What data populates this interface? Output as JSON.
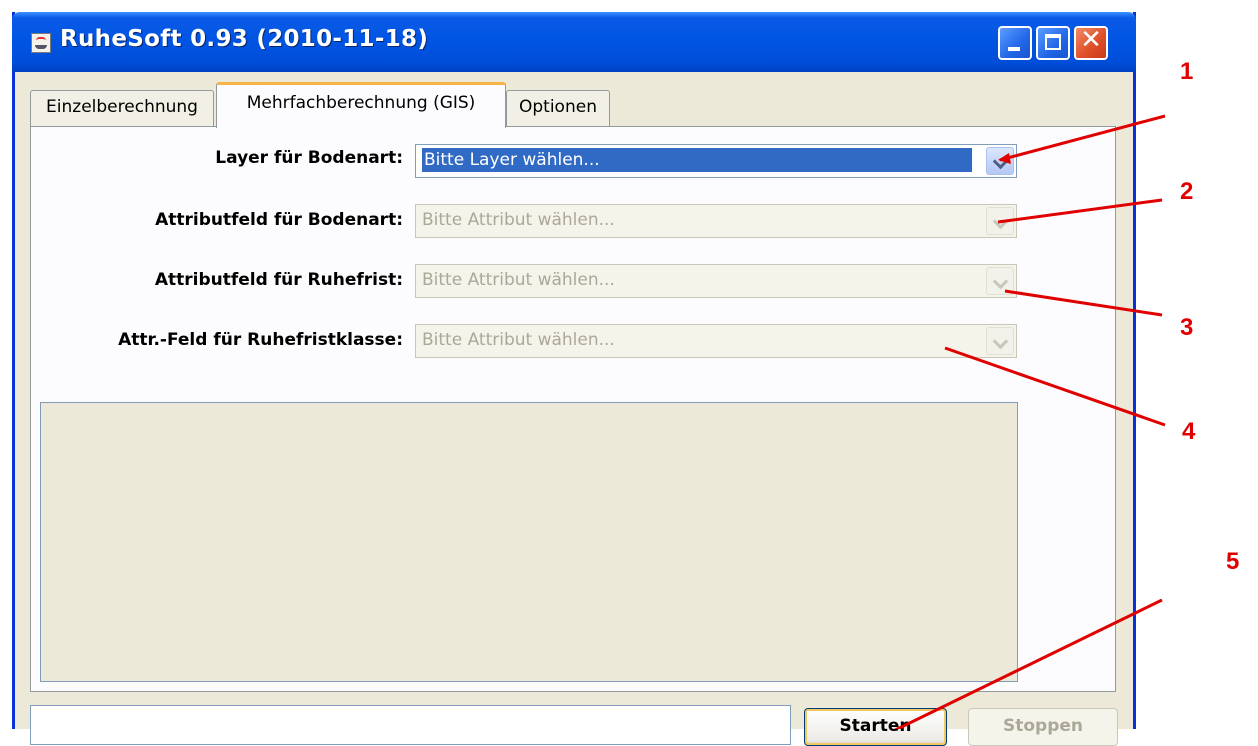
{
  "window": {
    "title": "RuheSoft 0.93 (2010-11-18)",
    "close_glyph": "✕"
  },
  "tabs": [
    {
      "label": "Einzelberechnung",
      "selected": false
    },
    {
      "label": "Mehrfachberechnung (GIS)",
      "selected": true
    },
    {
      "label": "Optionen",
      "selected": false
    }
  ],
  "form": {
    "fields": [
      {
        "label": "Layer für Bodenart:",
        "value": "Bitte Layer wählen...",
        "enabled": true
      },
      {
        "label": "Attributfeld für Bodenart:",
        "value": "Bitte Attribut wählen...",
        "enabled": false
      },
      {
        "label": "Attributfeld für Ruhefrist:",
        "value": "Bitte Attribut wählen...",
        "enabled": false
      },
      {
        "label": "Attr.-Feld für Ruhefristklasse:",
        "value": "Bitte Attribut wählen...",
        "enabled": false
      }
    ]
  },
  "buttons": {
    "start": "Starten",
    "stop": "Stoppen"
  },
  "status_field": {
    "value": ""
  },
  "callouts": [
    "1",
    "2",
    "3",
    "4",
    "5"
  ],
  "colors": {
    "titlebar": "#0054e3",
    "selection": "#316ac5",
    "active_tab_accent": "#f7b548",
    "callout": "#e00000"
  }
}
